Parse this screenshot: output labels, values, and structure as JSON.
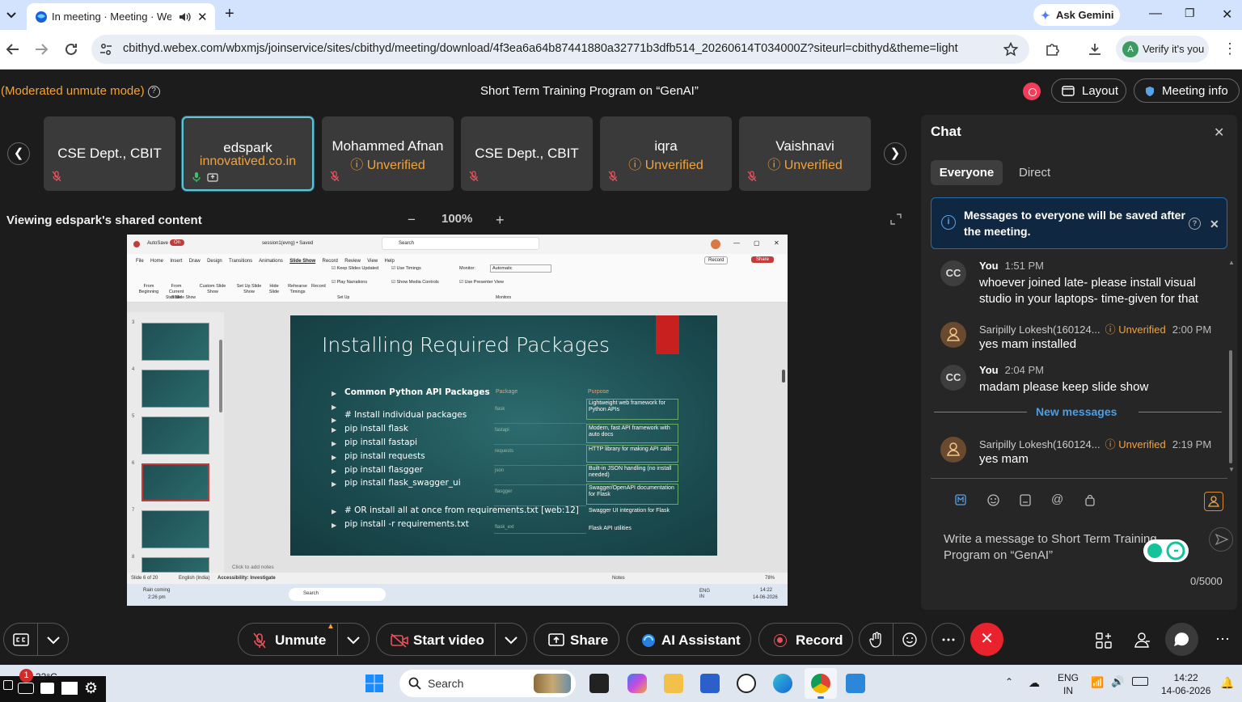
{
  "browser": {
    "tab_title": "In meeting · Meeting · Webex",
    "new_tab": "+",
    "ask_gemini": "Ask Gemini",
    "url": "cbithyd.webex.com/wbxmjs/joinservice/sites/cbithyd/meeting/download/4f3ea6a64b87441880a32771b3dfb514_20260614T034000Z?siteurl=cbithyd&theme=light",
    "verify": "Verify it's you",
    "profile_initial": "A"
  },
  "meeting": {
    "mode": "(Moderated unmute mode)",
    "title": "Short Term Training Program on “GenAI”",
    "layout": "Layout",
    "meeting_info": "Meeting info"
  },
  "participants": [
    {
      "name": "CSE Dept., CBIT",
      "sub": ""
    },
    {
      "name": "edspark",
      "sub": "innovatived.co.in"
    },
    {
      "name": "Mohammed Afnan",
      "sub": "Unverified"
    },
    {
      "name": "CSE Dept., CBIT",
      "sub": ""
    },
    {
      "name": "iqra",
      "sub": "Unverified"
    },
    {
      "name": "Vaishnavi",
      "sub": "Unverified"
    }
  ],
  "share": {
    "viewing": "Viewing edspark's shared content",
    "zoom": "100%",
    "zoom_out": "−",
    "zoom_in": "+"
  },
  "ppt": {
    "autosave": "AutoSave",
    "on": "On",
    "filename": "session1(evng) • Saved",
    "search": "Search",
    "menus": [
      "File",
      "Home",
      "Insert",
      "Draw",
      "Design",
      "Transitions",
      "Animations",
      "Slide Show",
      "Record",
      "Review",
      "View",
      "Help"
    ],
    "record_btn": "Record",
    "share_btn": "Share",
    "ribbon": [
      "From Beginning",
      "From Current Slide",
      "Custom Slide Show",
      "Set Up Slide Show",
      "Hide Slide",
      "Rehearse Timings",
      "Record"
    ],
    "checks": [
      "Keep Slides Updated",
      "Use Timings",
      "Play Narrations",
      "Show Media Controls",
      "Use Presenter View"
    ],
    "monitor_label": "Monitor:",
    "monitor_value": "Automatic",
    "groups": [
      "Start Slide Show",
      "Set Up",
      "Monitors"
    ],
    "thumb_numbers": [
      "3",
      "4",
      "5",
      "6",
      "7",
      "8"
    ],
    "notes": "Click to add notes",
    "status_left": "Slide 6 of 20",
    "status_lang": "English (India)",
    "status_access": "Accessibility: Investigate",
    "status_notes": "Notes",
    "status_zoom": "78%",
    "task_weather": "Rain coming",
    "task_weather_time": "2:26 pm",
    "task_search": "Search",
    "task_lang": "ENG IN",
    "task_time": "14:22",
    "task_date": "14-06-2026"
  },
  "slide": {
    "title": "Installing Required Packages",
    "bullets": [
      "Common Python API Packages",
      "",
      "# Install individual packages",
      "pip install flask",
      "pip install fastapi",
      "pip install requests",
      "pip install flasgger",
      "pip install flask_swagger_ui",
      "# OR install all at once from requirements.txt [web:12]",
      "pip install -r requirements.txt"
    ],
    "col_package": "Package",
    "col_purpose": "Purpose",
    "packages": [
      "flask",
      "fastapi",
      "requests",
      "json",
      "flasgger",
      "",
      "flask_ext"
    ],
    "purposes": [
      "Lightweight web framework for Python APIs",
      "Modern, fast API framework with auto docs",
      "HTTP library for making API calls",
      "Built-in JSON handling (no install needed)",
      "Swagger/OpenAPI documentation for Flask",
      "Swagger UI integration for Flask",
      "Flask API utilities"
    ]
  },
  "chat": {
    "title": "Chat",
    "tab_everyone": "Everyone",
    "tab_direct": "Direct",
    "notice": "Messages to everyone will be saved after the meeting.",
    "messages": [
      {
        "avatar": "CC",
        "name": "You",
        "time": "1:51 PM",
        "unverified": "",
        "text": "whoever joined late- please install visual studio in your laptops- time-given for that"
      },
      {
        "avatar": "",
        "name": "Saripilly Lokesh(160124...",
        "time": "2:00 PM",
        "unverified": "Unverified",
        "text": "yes mam installed"
      },
      {
        "avatar": "CC",
        "name": "You",
        "time": "2:04 PM",
        "unverified": "",
        "text": "madam please keep slide show"
      },
      {
        "avatar": "",
        "name": "Saripilly Lokesh(160124...",
        "time": "2:19 PM",
        "unverified": "Unverified",
        "text": "yes mam"
      }
    ],
    "new_messages": "New messages",
    "placeholder": "Write a message to Short Term Training Program on “GenAI”",
    "counter": "0/5000"
  },
  "controls": {
    "unmute": "Unmute",
    "start_video": "Start video",
    "share": "Share",
    "ai_assistant": "AI Assistant",
    "record": "Record"
  },
  "taskbar": {
    "temp": "32°C",
    "badge": "1",
    "search": "Search",
    "lang1": "ENG",
    "lang2": "IN",
    "time": "14:22",
    "date": "14-06-2026"
  },
  "colors": {
    "accent_orange": "#f2a23a",
    "accent_blue": "#4a9fe6",
    "end_call_red": "#e8232e",
    "record_red": "#f23d5a"
  }
}
